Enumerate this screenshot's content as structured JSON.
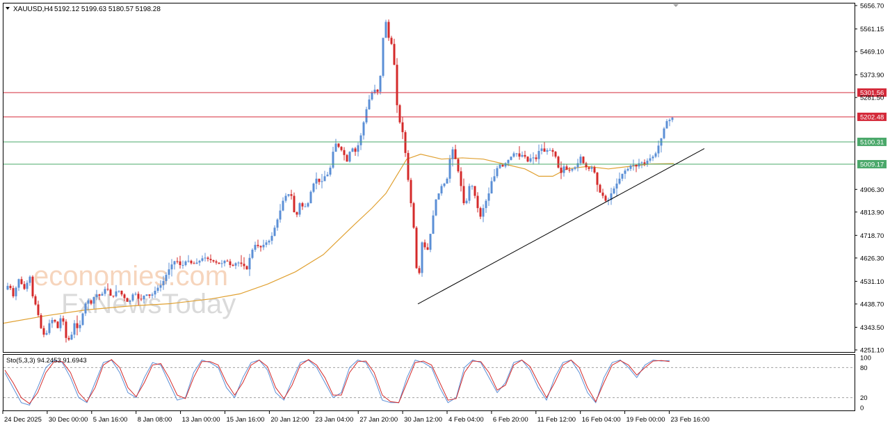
{
  "symbol_header": {
    "symbol": "XAUUSD,H4",
    "ohlc": "5192.12 5199.63 5180.57 5198.28"
  },
  "watermark": {
    "line1": "economies.com",
    "line2": "FxNewsToday"
  },
  "colors": {
    "bull": "#5b8fd6",
    "bear": "#d42a2a",
    "ma": "#e0a030",
    "resistance": "#d42a3a",
    "support": "#4aa86a",
    "trendline": "#000000",
    "stoch_main": "#5b8fd6",
    "stoch_signal": "#d42a2a"
  },
  "chart_data": [
    {
      "type": "candlestick",
      "title": "XAUUSD,H4",
      "price_axis_ticks": [
        "5656.70",
        "5561.15",
        "5469.10",
        "5373.90",
        "5281.50",
        "4906.30",
        "4813.90",
        "4718.70",
        "4626.30",
        "4531.10",
        "4438.70",
        "4343.50",
        "4251.10"
      ],
      "ylim": [
        4251.1,
        5656.7
      ],
      "time_labels": [
        "24 Dec 2025",
        "30 Dec 00:00",
        "5 Jan 16:00",
        "8 Jan 08:00",
        "13 Jan 00:00",
        "15 Jan 16:00",
        "20 Jan 12:00",
        "23 Jan 04:00",
        "27 Jan 20:00",
        "30 Jan 12:00",
        "4 Feb 04:00",
        "6 Feb 20:00",
        "11 Feb 12:00",
        "16 Feb 04:00",
        "19 Feb 00:00",
        "23 Feb 16:00"
      ],
      "horizontal_levels": [
        {
          "value": 5301.56,
          "label": "5301.56",
          "kind": "resistance"
        },
        {
          "value": 5202.48,
          "label": "5202.48",
          "kind": "resistance"
        },
        {
          "value": 5100.31,
          "label": "5100.31",
          "kind": "support"
        },
        {
          "value": 5009.17,
          "label": "5009.17",
          "kind": "support"
        }
      ],
      "price_path": [
        [
          0,
          4490
        ],
        [
          8,
          4520
        ],
        [
          14,
          4470
        ],
        [
          22,
          4540
        ],
        [
          30,
          4500
        ],
        [
          38,
          4550
        ],
        [
          42,
          4470
        ],
        [
          48,
          4420
        ],
        [
          54,
          4340
        ],
        [
          60,
          4300
        ],
        [
          66,
          4360
        ],
        [
          72,
          4380
        ],
        [
          78,
          4340
        ],
        [
          84,
          4400
        ],
        [
          90,
          4300
        ],
        [
          96,
          4290
        ],
        [
          102,
          4360
        ],
        [
          108,
          4330
        ],
        [
          114,
          4400
        ],
        [
          120,
          4460
        ],
        [
          126,
          4440
        ],
        [
          132,
          4480
        ],
        [
          140,
          4470
        ],
        [
          148,
          4510
        ],
        [
          156,
          4460
        ],
        [
          164,
          4500
        ],
        [
          172,
          4470
        ],
        [
          180,
          4440
        ],
        [
          188,
          4490
        ],
        [
          196,
          4450
        ],
        [
          204,
          4480
        ],
        [
          212,
          4470
        ],
        [
          220,
          4500
        ],
        [
          228,
          4520
        ],
        [
          236,
          4570
        ],
        [
          242,
          4600
        ],
        [
          248,
          4620
        ],
        [
          256,
          4590
        ],
        [
          264,
          4620
        ],
        [
          272,
          4600
        ],
        [
          280,
          4610
        ],
        [
          288,
          4630
        ],
        [
          296,
          4620
        ],
        [
          304,
          4610
        ],
        [
          312,
          4600
        ],
        [
          320,
          4620
        ],
        [
          328,
          4590
        ],
        [
          336,
          4610
        ],
        [
          344,
          4600
        ],
        [
          350,
          4580
        ],
        [
          356,
          4650
        ],
        [
          362,
          4680
        ],
        [
          370,
          4670
        ],
        [
          378,
          4690
        ],
        [
          384,
          4700
        ],
        [
          390,
          4750
        ],
        [
          396,
          4800
        ],
        [
          402,
          4860
        ],
        [
          408,
          4890
        ],
        [
          414,
          4880
        ],
        [
          420,
          4780
        ],
        [
          426,
          4850
        ],
        [
          432,
          4830
        ],
        [
          438,
          4850
        ],
        [
          444,
          4920
        ],
        [
          450,
          4950
        ],
        [
          456,
          4930
        ],
        [
          462,
          4960
        ],
        [
          468,
          4970
        ],
        [
          472,
          5020
        ],
        [
          476,
          5100
        ],
        [
          482,
          5080
        ],
        [
          488,
          5060
        ],
        [
          494,
          5020
        ],
        [
          500,
          5080
        ],
        [
          506,
          5060
        ],
        [
          512,
          5100
        ],
        [
          518,
          5180
        ],
        [
          524,
          5260
        ],
        [
          530,
          5300
        ],
        [
          536,
          5320
        ],
        [
          540,
          5290
        ],
        [
          544,
          5450
        ],
        [
          548,
          5600
        ],
        [
          552,
          5580
        ],
        [
          556,
          5470
        ],
        [
          560,
          5530
        ],
        [
          564,
          5300
        ],
        [
          568,
          5200
        ],
        [
          572,
          5160
        ],
        [
          576,
          5120
        ],
        [
          580,
          4990
        ],
        [
          584,
          4900
        ],
        [
          588,
          4800
        ],
        [
          592,
          4700
        ],
        [
          596,
          4470
        ],
        [
          600,
          4660
        ],
        [
          604,
          4720
        ],
        [
          608,
          4620
        ],
        [
          612,
          4700
        ],
        [
          616,
          4750
        ],
        [
          620,
          4850
        ],
        [
          624,
          4880
        ],
        [
          628,
          4900
        ],
        [
          632,
          4940
        ],
        [
          636,
          4920
        ],
        [
          640,
          4980
        ],
        [
          644,
          5080
        ],
        [
          648,
          5060
        ],
        [
          652,
          5000
        ],
        [
          656,
          4960
        ],
        [
          660,
          4880
        ],
        [
          664,
          4820
        ],
        [
          668,
          4900
        ],
        [
          672,
          4940
        ],
        [
          676,
          4900
        ],
        [
          680,
          4860
        ],
        [
          684,
          4800
        ],
        [
          688,
          4790
        ],
        [
          692,
          4870
        ],
        [
          696,
          4850
        ],
        [
          700,
          4930
        ],
        [
          706,
          4960
        ],
        [
          712,
          5010
        ],
        [
          718,
          5000
        ],
        [
          724,
          5020
        ],
        [
          730,
          5040
        ],
        [
          736,
          5060
        ],
        [
          742,
          5040
        ],
        [
          748,
          5050
        ],
        [
          754,
          5020
        ],
        [
          760,
          5040
        ],
        [
          766,
          5030
        ],
        [
          772,
          5080
        ],
        [
          778,
          5060
        ],
        [
          784,
          5070
        ],
        [
          790,
          5060
        ],
        [
          796,
          5030
        ],
        [
          800,
          4960
        ],
        [
          806,
          5000
        ],
        [
          812,
          4980
        ],
        [
          818,
          4990
        ],
        [
          824,
          5000
        ],
        [
          830,
          5040
        ],
        [
          836,
          5000
        ],
        [
          842,
          4990
        ],
        [
          848,
          5000
        ],
        [
          852,
          4950
        ],
        [
          856,
          4900
        ],
        [
          862,
          4880
        ],
        [
          868,
          4850
        ],
        [
          874,
          4890
        ],
        [
          880,
          4920
        ],
        [
          886,
          4950
        ],
        [
          892,
          4980
        ],
        [
          898,
          4990
        ],
        [
          904,
          5010
        ],
        [
          910,
          5000
        ],
        [
          916,
          5020
        ],
        [
          922,
          5010
        ],
        [
          928,
          5030
        ],
        [
          934,
          5040
        ],
        [
          940,
          5060
        ],
        [
          944,
          5110
        ],
        [
          948,
          5120
        ],
        [
          952,
          5190
        ],
        [
          956,
          5180
        ],
        [
          960,
          5200
        ],
        [
          964,
          5198
        ]
      ],
      "ma_path": [
        [
          0,
          4360
        ],
        [
          60,
          4390
        ],
        [
          120,
          4415
        ],
        [
          180,
          4430
        ],
        [
          240,
          4440
        ],
        [
          300,
          4460
        ],
        [
          340,
          4480
        ],
        [
          380,
          4520
        ],
        [
          420,
          4570
        ],
        [
          460,
          4640
        ],
        [
          500,
          4750
        ],
        [
          530,
          4830
        ],
        [
          550,
          4890
        ],
        [
          565,
          4960
        ],
        [
          580,
          5030
        ],
        [
          600,
          5050
        ],
        [
          630,
          5030
        ],
        [
          660,
          5035
        ],
        [
          690,
          5030
        ],
        [
          720,
          5010
        ],
        [
          750,
          4990
        ],
        [
          770,
          4960
        ],
        [
          790,
          4960
        ],
        [
          810,
          4990
        ],
        [
          840,
          5000
        ],
        [
          870,
          4990
        ],
        [
          900,
          5000
        ],
        [
          930,
          5010
        ],
        [
          964,
          5012
        ]
      ],
      "trendline": {
        "from": [
          596,
          4438.7
        ],
        "to": [
          1008,
          5073
        ]
      }
    },
    {
      "type": "line",
      "title": "Sto(5,3,3) 94.2453 91.6943",
      "indicator": "Sto(5,3,3)",
      "main_value": 94.2453,
      "signal_value": 91.6943,
      "ylim": [
        0,
        100
      ],
      "levels": [
        80,
        20
      ],
      "axis_ticks": [
        "100",
        "80",
        "20",
        "0"
      ],
      "series": [
        {
          "name": "main",
          "values": [
            70,
            40,
            10,
            5,
            40,
            80,
            95,
            90,
            60,
            20,
            10,
            50,
            90,
            95,
            70,
            30,
            20,
            60,
            90,
            85,
            50,
            15,
            20,
            70,
            95,
            90,
            80,
            40,
            20,
            60,
            90,
            95,
            75,
            30,
            15,
            55,
            90,
            95,
            80,
            50,
            20,
            30,
            80,
            95,
            90,
            60,
            15,
            10,
            10,
            60,
            95,
            90,
            80,
            40,
            10,
            20,
            80,
            95,
            90,
            60,
            30,
            50,
            90,
            95,
            75,
            40,
            15,
            60,
            90,
            95,
            70,
            30,
            10,
            60,
            90,
            95,
            80,
            60,
            85,
            95,
            93,
            94
          ]
        },
        {
          "name": "signal",
          "values": [
            75,
            50,
            20,
            8,
            30,
            70,
            92,
            92,
            70,
            30,
            12,
            40,
            85,
            96,
            80,
            40,
            22,
            50,
            85,
            88,
            60,
            25,
            18,
            60,
            92,
            92,
            85,
            50,
            25,
            50,
            85,
            95,
            82,
            40,
            18,
            45,
            85,
            96,
            85,
            60,
            25,
            25,
            70,
            92,
            93,
            70,
            25,
            12,
            10,
            50,
            90,
            93,
            85,
            50,
            15,
            18,
            70,
            93,
            92,
            70,
            35,
            45,
            85,
            95,
            82,
            50,
            20,
            50,
            85,
            95,
            80,
            40,
            12,
            50,
            85,
            94,
            85,
            65,
            80,
            93,
            94,
            92
          ]
        }
      ]
    }
  ]
}
